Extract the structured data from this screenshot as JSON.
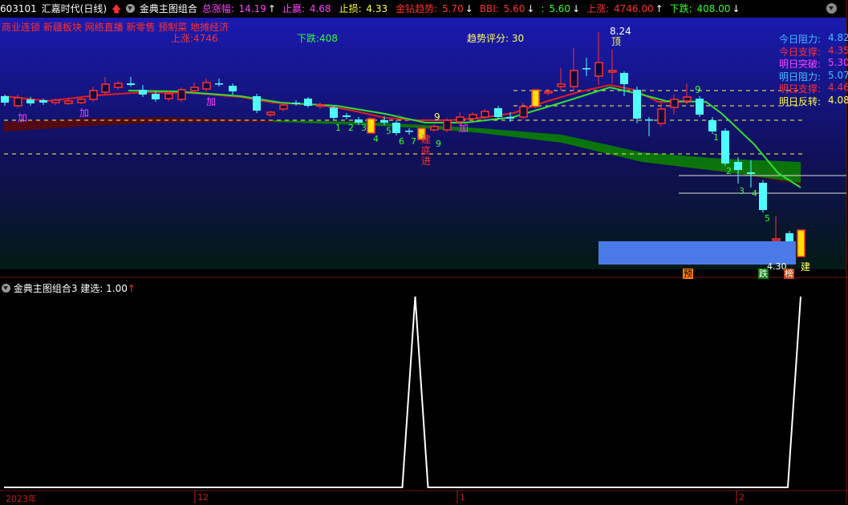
{
  "header": {
    "code": "603101",
    "name": "汇嘉时代(日线)",
    "indicator": "金典主图组合",
    "fields": [
      {
        "label": "总涨幅:",
        "value": "14.19",
        "arrow": "↑",
        "color": "#ff40ff"
      },
      {
        "label": "止赢:",
        "value": "4.68",
        "arrow": "",
        "color": "#ff40ff"
      },
      {
        "label": "止损:",
        "value": "4.33",
        "arrow": "",
        "color": "#ffff40"
      },
      {
        "label": "金钻趋势:",
        "value": "5.70",
        "arrow": "↓",
        "color": "#ff3030"
      },
      {
        "label": "BBI:",
        "value": "5.60",
        "arrow": "↓",
        "color": "#ff3030"
      },
      {
        "label": ":",
        "value": "5.60",
        "arrow": "↓",
        "color": "#30ff30"
      },
      {
        "label": "上涨:",
        "value": "4746.00",
        "arrow": "↑",
        "color": "#ff3030"
      },
      {
        "label": "下跌:",
        "value": "408.00",
        "arrow": "↓",
        "color": "#30ff30"
      }
    ]
  },
  "main": {
    "sectors": "商业连锁 新疆板块 网络直播 新零售 预制菜 地摊经济",
    "up_label": "上涨:4746",
    "down_label": "下跌:408",
    "trend_score": "趋势评分: 30",
    "peak_label": "8.24",
    "peak_tag": "顶",
    "bottom_label": "4.30",
    "jian_label": "建",
    "signals": {
      "jia": "加",
      "jiandi": [
        "建",
        "底",
        "进"
      ],
      "nine": "9"
    },
    "right_levels": [
      {
        "label": "今日阻力:",
        "value": "4.82",
        "color": "#40c0ff"
      },
      {
        "label": "今日支撑:",
        "value": "4.35",
        "color": "#ff3030"
      },
      {
        "label": "明日突破:",
        "value": "5.30",
        "color": "#ff40ff"
      },
      {
        "label": "明日阻力:",
        "value": "5.07",
        "color": "#40c0ff"
      },
      {
        "label": "明日支撑:",
        "value": "4.46",
        "color": "#ff3030"
      },
      {
        "label": "明日反转:",
        "value": "4.08",
        "color": "#ffff40"
      }
    ],
    "bottom_badges": [
      {
        "text": "预",
        "bg": "#ff8000",
        "color": "#000"
      },
      {
        "text": "跌",
        "bg": "#108010",
        "color": "#fff"
      },
      {
        "text": "榜",
        "bg": "#c04010",
        "color": "#fff"
      }
    ]
  },
  "sub": {
    "title": "金典主图组合3",
    "label": "建选:",
    "value": "1.00",
    "arrow": "↑"
  },
  "xaxis": {
    "labels": [
      "2023年",
      "12",
      "1",
      "2"
    ]
  },
  "chart_data": {
    "type": "line",
    "title": "建选",
    "x": [
      "2023年",
      "12",
      "1",
      "2"
    ],
    "series": [
      {
        "name": "建选",
        "values": [
          0,
          0,
          0,
          0,
          0,
          0,
          0,
          0,
          0,
          0,
          0,
          0,
          0,
          0,
          0,
          0,
          0,
          0,
          0,
          0,
          0,
          0,
          0,
          0,
          0,
          0,
          0,
          0,
          0,
          0,
          0,
          0,
          1,
          0,
          0,
          0,
          0,
          0,
          0,
          0,
          0,
          0,
          0,
          0,
          0,
          0,
          0,
          0,
          0,
          0,
          0,
          0,
          0,
          0,
          0,
          0,
          0,
          0,
          0,
          0,
          0,
          0,
          1
        ]
      }
    ],
    "ylim": [
      0,
      1
    ]
  },
  "colors": {
    "up": "#ff3030",
    "down": "#50ffff",
    "ma_red": "#e02020",
    "ma_green": "#30e030",
    "band_green": "#0a7a0a",
    "band_red": "#5a0a0a"
  }
}
